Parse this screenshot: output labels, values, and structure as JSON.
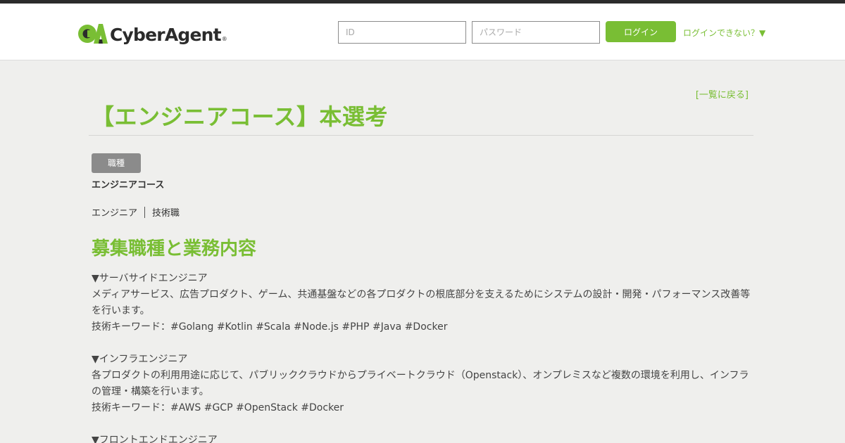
{
  "header": {
    "logo_text": "CyberAgent",
    "logo_reg": "®",
    "id_placeholder": "ID",
    "password_placeholder": "パスワード",
    "login_label": "ログイン",
    "forgot_label": "ログインできない？▼"
  },
  "main": {
    "back_link": "[一覧に戻る]",
    "title": "【エンジニアコース】本選考",
    "job_type_label": "職種",
    "course_name": "エンジニアコース",
    "tags": [
      "エンジニア",
      "技術職"
    ],
    "section_title": "募集職種と業務内容",
    "body": "▼サーバサイドエンジニア\nメディアサービス、広告プロダクト、ゲーム、共通基盤などの各プロダクトの根底部分を支えるためにシステムの設計・開発・パフォーマンス改善等を行います。\n技術キーワード：#Golang #Kotlin #Scala #Node.js #PHP #Java #Docker\n\n▼インフラエンジニア\n各プロダクトの利用用途に応じて、パブリッククラウドからプライベートクラウド（Openstack）、オンプレミスなど複数の環境を利用し、インフラの管理・構築を行います。\n技術キーワード：#AWS #GCP #OpenStack #Docker\n\n▼フロントエンドエンジニア"
  },
  "colors": {
    "accent": "#79be34",
    "logo_dark": "#2b2b2b",
    "badge": "#8b8b8b",
    "background": "#efefed"
  }
}
